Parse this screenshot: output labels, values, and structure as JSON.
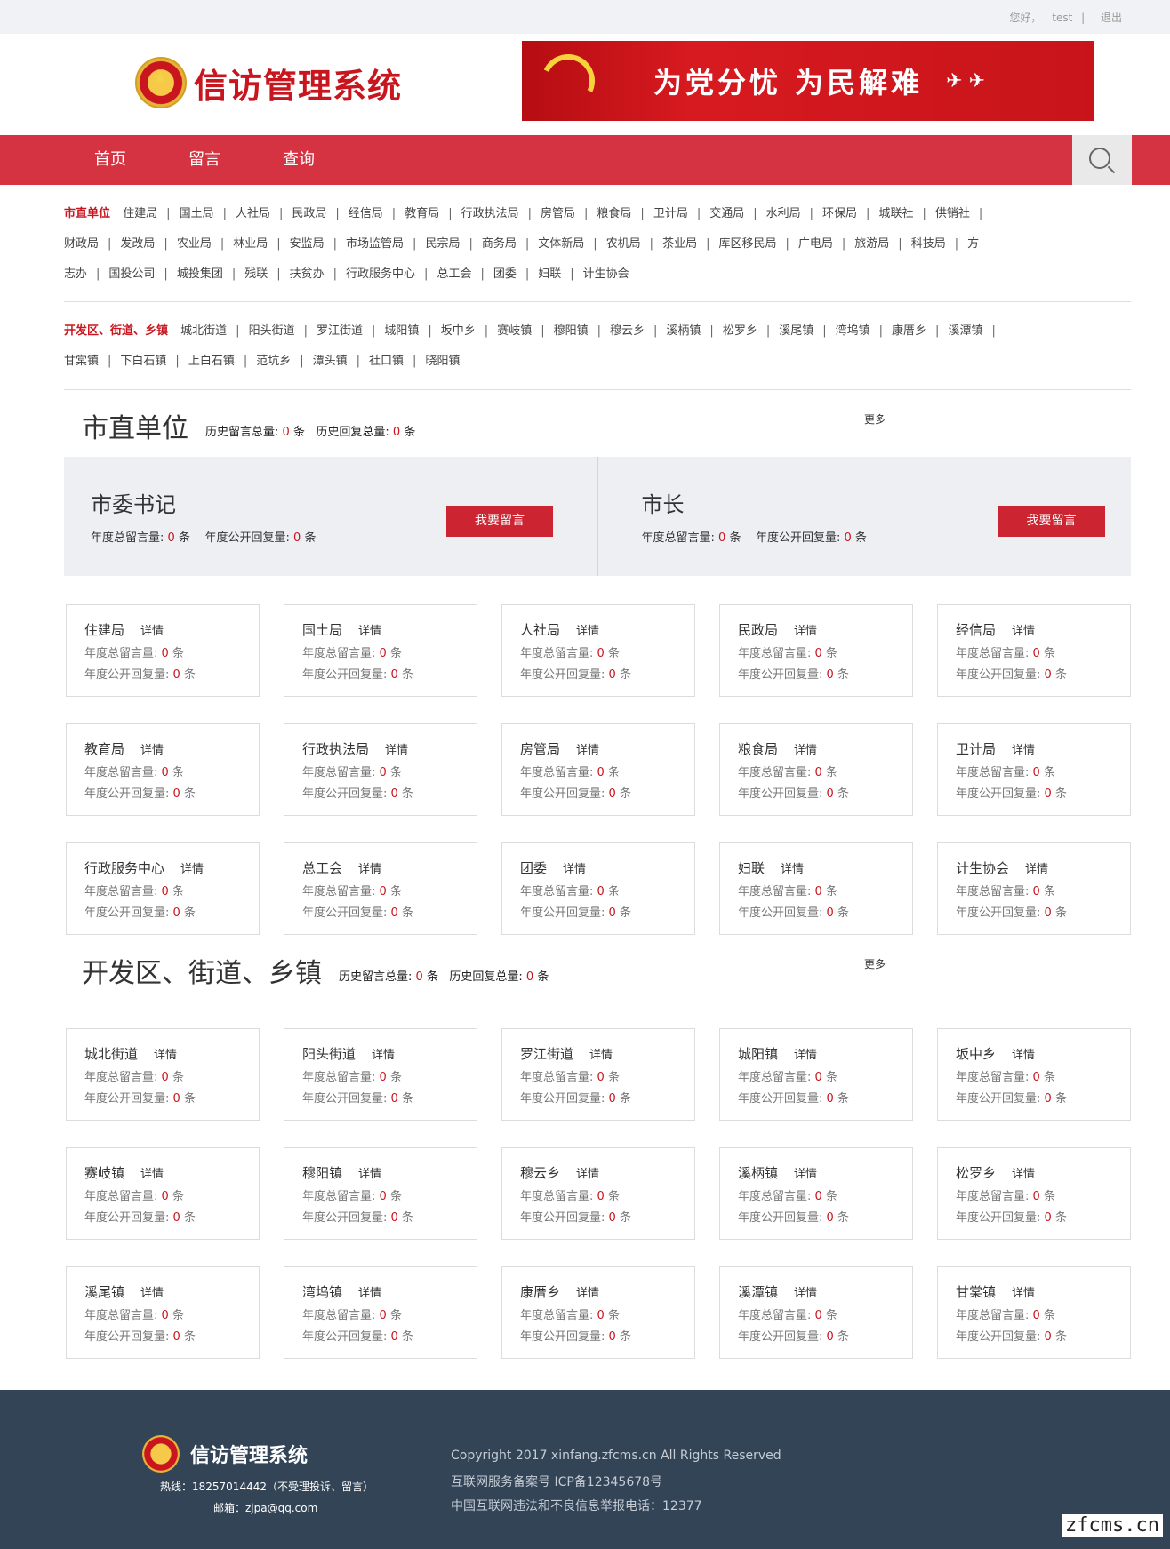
{
  "topbar": {
    "greeting": "您好，",
    "user": "test",
    "sep": "|",
    "logout": "退出"
  },
  "header": {
    "logo_text": "信访管理系统",
    "banner_text": "为党分忧 为民解难"
  },
  "nav": {
    "items": [
      "首页",
      "留言",
      "查询"
    ]
  },
  "links": {
    "city_label": "市直单位",
    "city_rows": [
      [
        "住建局",
        "国土局",
        "人社局",
        "民政局",
        "经信局",
        "教育局",
        "行政执法局",
        "房管局",
        "粮食局",
        "卫计局",
        "交通局",
        "水利局",
        "环保局",
        "城联社",
        "供销社"
      ],
      [
        "财政局",
        "发改局",
        "农业局",
        "林业局",
        "安监局",
        "市场监管局",
        "民宗局",
        "商务局",
        "文体新局",
        "农机局",
        "茶业局",
        "库区移民局",
        "广电局",
        "旅游局",
        "科技局",
        "方"
      ],
      [
        "志办",
        "国投公司",
        "城投集团",
        "残联",
        "扶贫办",
        "行政服务中心",
        "总工会",
        "团委",
        "妇联",
        "计生协会"
      ]
    ],
    "town_label": "开发区、街道、乡镇",
    "town_rows": [
      [
        "城北街道",
        "阳头街道",
        "罗江街道",
        "城阳镇",
        "坂中乡",
        "赛岐镇",
        "穆阳镇",
        "穆云乡",
        "溪柄镇",
        "松罗乡",
        "溪尾镇",
        "湾坞镇",
        "康厝乡",
        "溪潭镇"
      ],
      [
        "甘棠镇",
        "下白石镇",
        "上白石镇",
        "范坑乡",
        "潭头镇",
        "社口镇",
        "晓阳镇"
      ]
    ]
  },
  "labels": {
    "hist_msg": "历史留言总量:",
    "hist_reply": "历史回复总量:",
    "unit": "条",
    "more": "更多",
    "detail": "详情",
    "year_msg": "年度总留言量:",
    "year_reply": "年度公开回复量:",
    "leave_msg": "我要留言"
  },
  "city_section": {
    "title": "市直单位",
    "hist_msg": "0",
    "hist_reply": "0"
  },
  "leaders": [
    {
      "name": "市委书记",
      "year_msg": "0",
      "year_reply": "0"
    },
    {
      "name": "市长",
      "year_msg": "0",
      "year_reply": "0"
    }
  ],
  "city_cards": [
    {
      "name": "住建局",
      "msg": "0",
      "reply": "0"
    },
    {
      "name": "国土局",
      "msg": "0",
      "reply": "0"
    },
    {
      "name": "人社局",
      "msg": "0",
      "reply": "0"
    },
    {
      "name": "民政局",
      "msg": "0",
      "reply": "0"
    },
    {
      "name": "经信局",
      "msg": "0",
      "reply": "0"
    },
    {
      "name": "教育局",
      "msg": "0",
      "reply": "0"
    },
    {
      "name": "行政执法局",
      "msg": "0",
      "reply": "0"
    },
    {
      "name": "房管局",
      "msg": "0",
      "reply": "0"
    },
    {
      "name": "粮食局",
      "msg": "0",
      "reply": "0"
    },
    {
      "name": "卫计局",
      "msg": "0",
      "reply": "0"
    },
    {
      "name": "行政服务中心",
      "msg": "0",
      "reply": "0"
    },
    {
      "name": "总工会",
      "msg": "0",
      "reply": "0"
    },
    {
      "name": "团委",
      "msg": "0",
      "reply": "0"
    },
    {
      "name": "妇联",
      "msg": "0",
      "reply": "0"
    },
    {
      "name": "计生协会",
      "msg": "0",
      "reply": "0"
    }
  ],
  "town_section": {
    "title": "开发区、街道、乡镇",
    "hist_msg": "0",
    "hist_reply": "0"
  },
  "town_cards": [
    {
      "name": "城北街道",
      "msg": "0",
      "reply": "0"
    },
    {
      "name": "阳头街道",
      "msg": "0",
      "reply": "0"
    },
    {
      "name": "罗江街道",
      "msg": "0",
      "reply": "0"
    },
    {
      "name": "城阳镇",
      "msg": "0",
      "reply": "0"
    },
    {
      "name": "坂中乡",
      "msg": "0",
      "reply": "0"
    },
    {
      "name": "赛岐镇",
      "msg": "0",
      "reply": "0"
    },
    {
      "name": "穆阳镇",
      "msg": "0",
      "reply": "0"
    },
    {
      "name": "穆云乡",
      "msg": "0",
      "reply": "0"
    },
    {
      "name": "溪柄镇",
      "msg": "0",
      "reply": "0"
    },
    {
      "name": "松罗乡",
      "msg": "0",
      "reply": "0"
    },
    {
      "name": "溪尾镇",
      "msg": "0",
      "reply": "0"
    },
    {
      "name": "湾坞镇",
      "msg": "0",
      "reply": "0"
    },
    {
      "name": "康厝乡",
      "msg": "0",
      "reply": "0"
    },
    {
      "name": "溪潭镇",
      "msg": "0",
      "reply": "0"
    },
    {
      "name": "甘棠镇",
      "msg": "0",
      "reply": "0"
    }
  ],
  "footer": {
    "logo_text": "信访管理系统",
    "hotline": "热线：18257014442（不受理投诉、留言）",
    "email": "邮箱：zjpa@qq.com",
    "copyright": "Copyright 2017 xinfang.zfcms.cn All Rights Reserved",
    "icp": "互联网服务备案号 ICP备12345678号",
    "report": "中国互联网违法和不良信息举报电话：12377"
  },
  "watermark": "zfcms.cn",
  "colors": {
    "nav": "#d53342",
    "accent": "#c9151e",
    "footer": "#334456"
  }
}
